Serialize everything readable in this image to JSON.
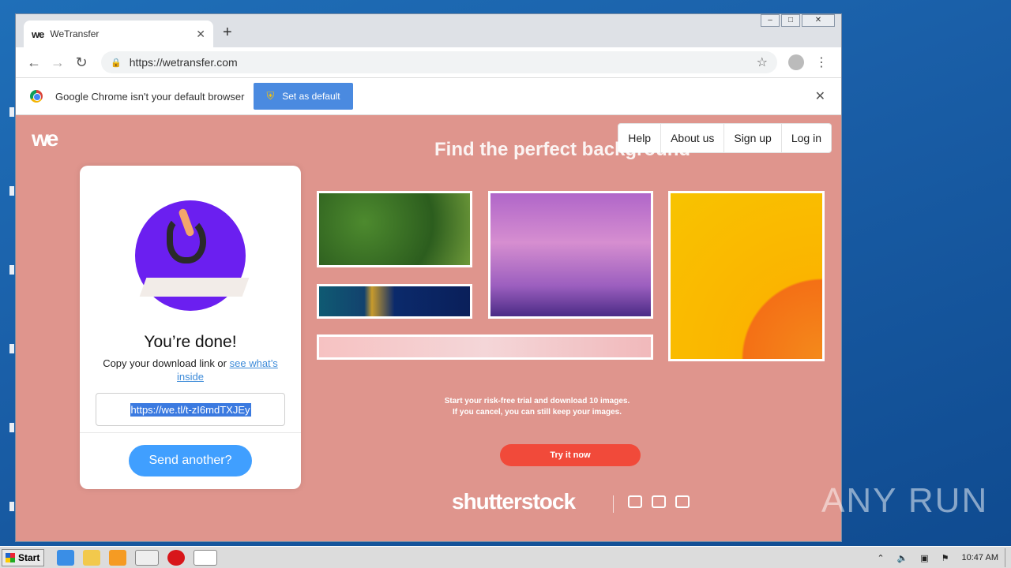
{
  "browser": {
    "tab_title": "WeTransfer",
    "tab_favicon": "we",
    "new_tab": "+",
    "url": "https://wetransfer.com",
    "infobar_message": "Google Chrome isn't your default browser",
    "set_default_label": "Set as default"
  },
  "page": {
    "logo": "we",
    "nav": [
      "Help",
      "About us",
      "Sign up",
      "Log in"
    ],
    "panel": {
      "title": "You’re done!",
      "desc_prefix": "Copy your download link or",
      "desc_link": "see what’s inside",
      "download_link": "https://we.tl/t-zI6mdTXJEy",
      "send_another": "Send another?"
    },
    "ad": {
      "title": "Find the perfect background",
      "line1": "Start your risk-free trial and download 10 images.",
      "line2": "If you cancel, you can still keep your images.",
      "cta": "Try it now",
      "brand": "shutterstock"
    }
  },
  "watermark": "ANY RUN",
  "taskbar": {
    "start_label": "Start",
    "clock": "10:47 AM"
  },
  "colors": {
    "page_bg": "#df958d",
    "accent_blue": "#409fff",
    "cta_red": "#f14a3a",
    "illustration_purple": "#6b1ff0"
  }
}
